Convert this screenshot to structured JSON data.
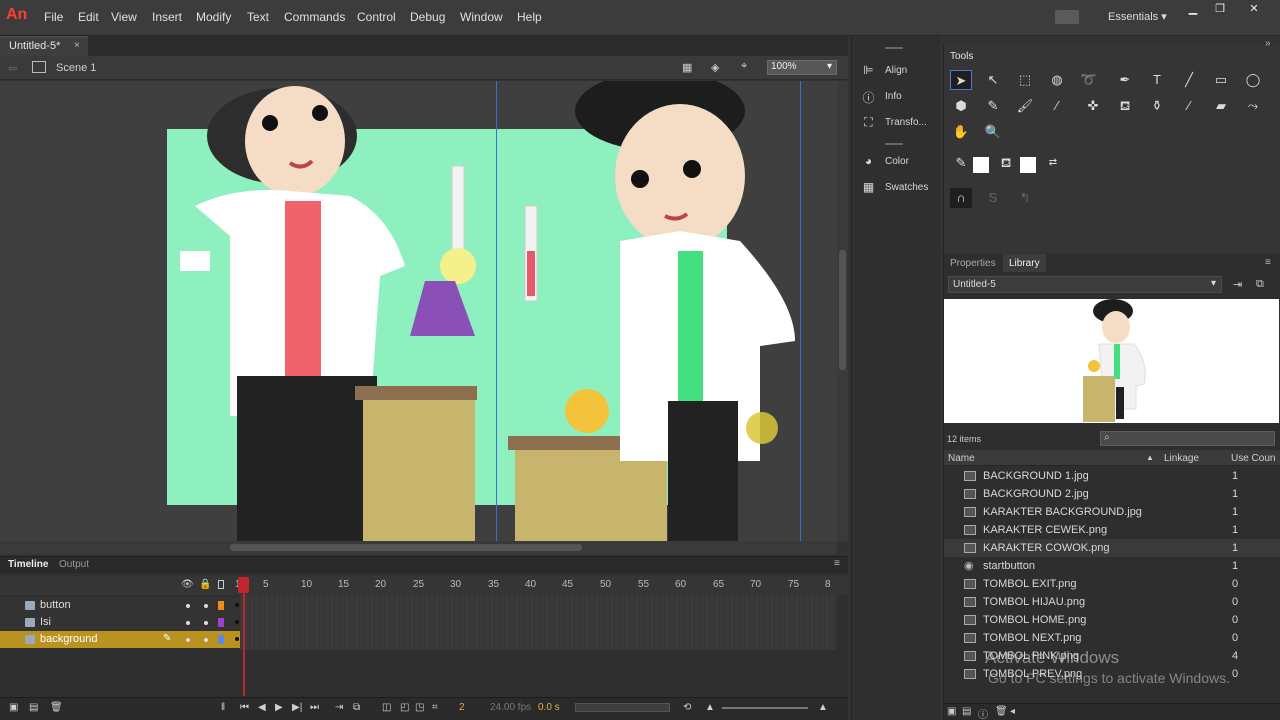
{
  "app": {
    "logo": "An"
  },
  "menu": [
    "File",
    "Edit",
    "View",
    "Insert",
    "Modify",
    "Text",
    "Commands",
    "Control",
    "Debug",
    "Window",
    "Help"
  ],
  "workspace": "Essentials",
  "document": {
    "tab_label": "Untitled-5*",
    "close": "×",
    "scene": "Scene 1",
    "zoom": "100%"
  },
  "mid_panels": [
    "Align",
    "Info",
    "Transfo...",
    "Color",
    "Swatches"
  ],
  "tools": {
    "title": "Tools"
  },
  "timeline": {
    "tabs": [
      "Timeline",
      "Output"
    ],
    "frame_numbers": [
      "1",
      "5",
      "10",
      "15",
      "20",
      "25",
      "30",
      "35",
      "40",
      "45",
      "50",
      "55",
      "60",
      "65",
      "70",
      "75",
      "8"
    ],
    "layers": [
      {
        "name": "button",
        "color": "#f08a1d",
        "selected": false
      },
      {
        "name": "Isi",
        "color": "#9b3fd0",
        "selected": false
      },
      {
        "name": "background",
        "color": "#5b8be0",
        "selected": true
      }
    ],
    "current_frame": "2",
    "fps": "24.00 fps",
    "time": "0.0 s"
  },
  "library": {
    "tabs": [
      "Properties",
      "Library"
    ],
    "document": "Untitled-5",
    "count": "12 items",
    "columns": [
      "Name",
      "Linkage",
      "Use Coun"
    ],
    "items": [
      {
        "name": "BACKGROUND 1.jpg",
        "use": "1"
      },
      {
        "name": "BACKGROUND 2.jpg",
        "use": "1"
      },
      {
        "name": "KARAKTER BACKGROUND.jpg",
        "use": "1"
      },
      {
        "name": "KARAKTER CEWEK.png",
        "use": "1"
      },
      {
        "name": "KARAKTER COWOK.png",
        "use": "1"
      },
      {
        "name": "startbutton",
        "use": "1"
      },
      {
        "name": "TOMBOL EXIT.png",
        "use": "0"
      },
      {
        "name": "TOMBOL HIJAU.png",
        "use": "0"
      },
      {
        "name": "TOMBOL HOME.png",
        "use": "0"
      },
      {
        "name": "TOMBOL NEXT.png",
        "use": "0"
      },
      {
        "name": "TOMBOL PINK.png",
        "use": "4"
      },
      {
        "name": "TOMBOL PREV.png",
        "use": "0"
      }
    ]
  },
  "watermark": {
    "line1": "Activate Windows",
    "line2": "Go to PC settings to activate Windows."
  }
}
